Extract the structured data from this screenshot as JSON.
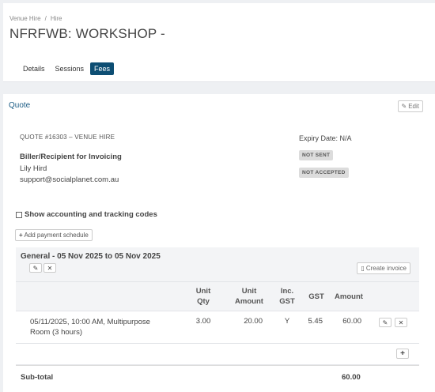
{
  "breadcrumb": {
    "items": [
      "Venue Hire",
      "Hire"
    ],
    "separator": "/"
  },
  "page": {
    "title": "NFRFWB: WORKSHOP -"
  },
  "tabs": [
    {
      "label": "Details",
      "active": false
    },
    {
      "label": "Sessions",
      "active": false
    },
    {
      "label": "Fees",
      "active": true
    }
  ],
  "quote": {
    "title": "Quote",
    "edit_label": "Edit",
    "number": "QUOTE #16303 – VENUE HIRE",
    "expiry": "Expiry Date: N/A",
    "biller_heading": "Biller/Recipient for Invoicing",
    "biller_name": "Lily Hird",
    "biller_email": "support@socialplanet.com.au",
    "status_badges": [
      "NOT SENT",
      "NOT ACCEPTED"
    ],
    "show_codes_label": "Show accounting and tracking codes",
    "add_schedule_label": "Add payment schedule"
  },
  "section": {
    "title": "General - 05 Nov 2025 to 05 Nov 2025",
    "create_invoice_label": "Create invoice",
    "columns": {
      "unit_qty": [
        "Unit",
        "Qty"
      ],
      "unit_amount": [
        "Unit",
        "Amount"
      ],
      "inc_gst": [
        "Inc.",
        "GST"
      ],
      "gst": "GST",
      "amount": "Amount"
    },
    "rows": [
      {
        "description_line1": "05/11/2025, 10:00 AM, Multipurpose",
        "description_line2": "Room (3 hours)",
        "unit_qty": "3.00",
        "unit_amount": "20.00",
        "inc_gst": "Y",
        "gst": "5.45",
        "amount": "60.00"
      }
    ],
    "subtotal_label": "Sub-total",
    "subtotal_value": "60.00"
  },
  "colors": {
    "accent": "#0d4e73",
    "link": "#1a5b84",
    "badge_bg": "#dcdcdc"
  },
  "icons": [
    "pencil-icon",
    "close-icon",
    "document-icon",
    "plus-icon"
  ]
}
